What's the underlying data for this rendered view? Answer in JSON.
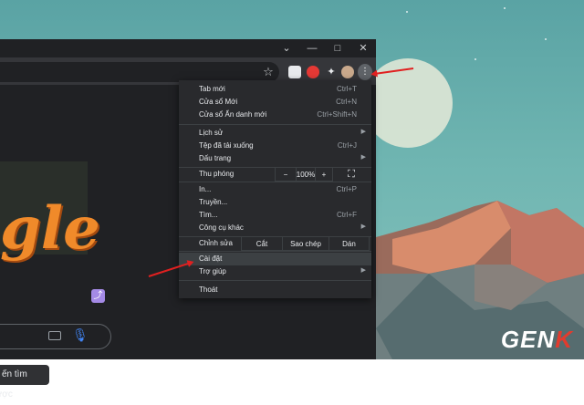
{
  "menu": {
    "new_tab": {
      "label": "Tab mới",
      "shortcut": "Ctrl+T"
    },
    "new_window": {
      "label": "Cửa sổ Mới",
      "shortcut": "Ctrl+N"
    },
    "incognito": {
      "label": "Cửa sổ Ẩn danh mới",
      "shortcut": "Ctrl+Shift+N"
    },
    "history": {
      "label": "Lịch sử"
    },
    "downloads": {
      "label": "Tệp đã tải xuống",
      "shortcut": "Ctrl+J"
    },
    "bookmarks": {
      "label": "Dấu trang"
    },
    "zoom": {
      "label": "Thu phóng",
      "minus": "−",
      "value": "100%",
      "plus": "+"
    },
    "print": {
      "label": "In...",
      "shortcut": "Ctrl+P"
    },
    "cast": {
      "label": "Truyền..."
    },
    "find": {
      "label": "Tìm...",
      "shortcut": "Ctrl+F"
    },
    "more_tools": {
      "label": "Công cụ khác"
    },
    "edit": {
      "label": "Chỉnh sửa",
      "cut": "Cắt",
      "copy": "Sao chép",
      "paste": "Dán"
    },
    "settings": {
      "label": "Cài đặt"
    },
    "help": {
      "label": "Trợ giúp"
    },
    "exit": {
      "label": "Thoát"
    }
  },
  "page": {
    "button_partial": "ến tìm được"
  },
  "watermark": {
    "text_a": "GEN",
    "text_b": "K"
  },
  "colors": {
    "accent_red": "#e02020",
    "menu_bg": "#292a2d",
    "browser_bg": "#202124"
  }
}
